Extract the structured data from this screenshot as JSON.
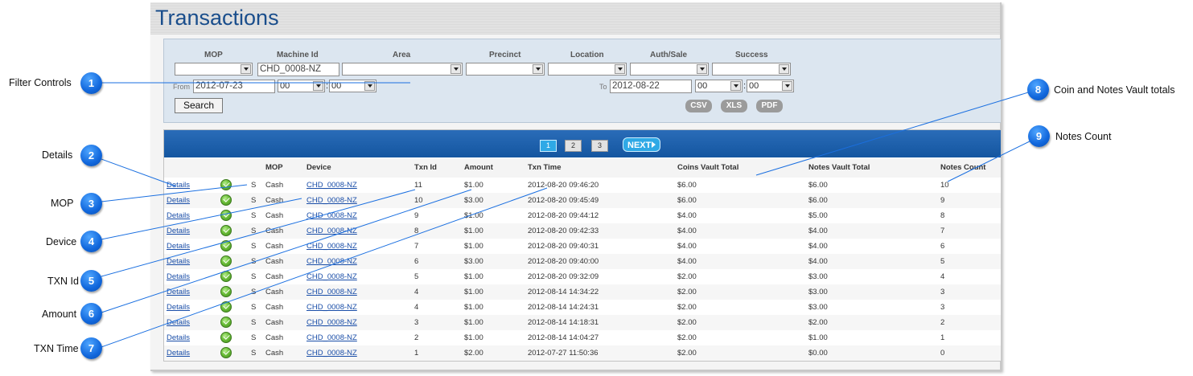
{
  "title": "Transactions",
  "filters": {
    "labels": {
      "mop": "MOP",
      "machine_id": "Machine Id",
      "area": "Area",
      "precinct": "Precinct",
      "location": "Location",
      "auth_sale": "Auth/Sale",
      "success": "Success"
    },
    "machine_id_value": "CHD_0008-NZ",
    "from_label": "From",
    "from_date": "2012-07-23",
    "from_hour": "00",
    "from_minute": "00",
    "to_label": "To",
    "to_date": "2012-08-22",
    "to_hour": "00",
    "to_minute": "00",
    "time_separator": ":",
    "search_label": "Search",
    "export": {
      "csv": "CSV",
      "xls": "XLS",
      "pdf": "PDF"
    }
  },
  "pager": {
    "pages": [
      "1",
      "2",
      "3"
    ],
    "active_page": "1",
    "next_label": "NEXT"
  },
  "table": {
    "columns": {
      "mop": "MOP",
      "device": "Device",
      "txn_id": "Txn Id",
      "amount": "Amount",
      "txn_time": "Txn Time",
      "coins_vault_total": "Coins Vault Total",
      "notes_vault_total": "Notes Vault Total",
      "notes_count": "Notes Count"
    },
    "rows": [
      {
        "details": "Details",
        "status": "S",
        "mop": "Cash",
        "device": "CHD_0008-NZ",
        "txn_id": "11",
        "amount": "$1.00",
        "txn_time": "2012-08-20 09:46:20",
        "coins": "$6.00",
        "notes": "$6.00",
        "count": "10"
      },
      {
        "details": "Details",
        "status": "S",
        "mop": "Cash",
        "device": "CHD_0008-NZ",
        "txn_id": "10",
        "amount": "$3.00",
        "txn_time": "2012-08-20 09:45:49",
        "coins": "$6.00",
        "notes": "$6.00",
        "count": "9"
      },
      {
        "details": "Details",
        "status": "S",
        "mop": "Cash",
        "device": "CHD_0008-NZ",
        "txn_id": "9",
        "amount": "$1.00",
        "txn_time": "2012-08-20 09:44:12",
        "coins": "$4.00",
        "notes": "$5.00",
        "count": "8"
      },
      {
        "details": "Details",
        "status": "S",
        "mop": "Cash",
        "device": "CHD_0008-NZ",
        "txn_id": "8",
        "amount": "$1.00",
        "txn_time": "2012-08-20 09:42:33",
        "coins": "$4.00",
        "notes": "$4.00",
        "count": "7"
      },
      {
        "details": "Details",
        "status": "S",
        "mop": "Cash",
        "device": "CHD_0008-NZ",
        "txn_id": "7",
        "amount": "$1.00",
        "txn_time": "2012-08-20 09:40:31",
        "coins": "$4.00",
        "notes": "$4.00",
        "count": "6"
      },
      {
        "details": "Details",
        "status": "S",
        "mop": "Cash",
        "device": "CHD_0008-NZ",
        "txn_id": "6",
        "amount": "$3.00",
        "txn_time": "2012-08-20 09:40:00",
        "coins": "$4.00",
        "notes": "$4.00",
        "count": "5"
      },
      {
        "details": "Details",
        "status": "S",
        "mop": "Cash",
        "device": "CHD_0008-NZ",
        "txn_id": "5",
        "amount": "$1.00",
        "txn_time": "2012-08-20 09:32:09",
        "coins": "$2.00",
        "notes": "$3.00",
        "count": "4"
      },
      {
        "details": "Details",
        "status": "S",
        "mop": "Cash",
        "device": "CHD_0008-NZ",
        "txn_id": "4",
        "amount": "$1.00",
        "txn_time": "2012-08-14 14:34:22",
        "coins": "$2.00",
        "notes": "$3.00",
        "count": "3"
      },
      {
        "details": "Details",
        "status": "S",
        "mop": "Cash",
        "device": "CHD_0008-NZ",
        "txn_id": "4",
        "amount": "$1.00",
        "txn_time": "2012-08-14 14:24:31",
        "coins": "$2.00",
        "notes": "$3.00",
        "count": "3"
      },
      {
        "details": "Details",
        "status": "S",
        "mop": "Cash",
        "device": "CHD_0008-NZ",
        "txn_id": "3",
        "amount": "$1.00",
        "txn_time": "2012-08-14 14:18:31",
        "coins": "$2.00",
        "notes": "$2.00",
        "count": "2"
      },
      {
        "details": "Details",
        "status": "S",
        "mop": "Cash",
        "device": "CHD_0008-NZ",
        "txn_id": "2",
        "amount": "$1.00",
        "txn_time": "2012-08-14 14:04:27",
        "coins": "$2.00",
        "notes": "$1.00",
        "count": "1"
      },
      {
        "details": "Details",
        "status": "S",
        "mop": "Cash",
        "device": "CHD_0008-NZ",
        "txn_id": "1",
        "amount": "$2.00",
        "txn_time": "2012-07-27 11:50:36",
        "coins": "$2.00",
        "notes": "$0.00",
        "count": "0"
      }
    ]
  },
  "callouts": [
    {
      "number": "1",
      "label": "Filter Controls"
    },
    {
      "number": "2",
      "label": "Details"
    },
    {
      "number": "3",
      "label": "MOP"
    },
    {
      "number": "4",
      "label": "Device"
    },
    {
      "number": "5",
      "label": "TXN Id"
    },
    {
      "number": "6",
      "label": "Amount"
    },
    {
      "number": "7",
      "label": "TXN Time"
    },
    {
      "number": "8",
      "label": "Coin and Notes Vault totals"
    },
    {
      "number": "9",
      "label": "Notes Count"
    }
  ],
  "colors": {
    "title": "#1a4e8c",
    "callout": "#1167dc",
    "pager": "#1a5ca8",
    "link": "#1a4ea8",
    "status_ok": "#6cbf3a"
  },
  "icons": {
    "status": "check-circle-icon",
    "next": "triangle-right-icon",
    "dropdown": "chevron-down-icon"
  }
}
